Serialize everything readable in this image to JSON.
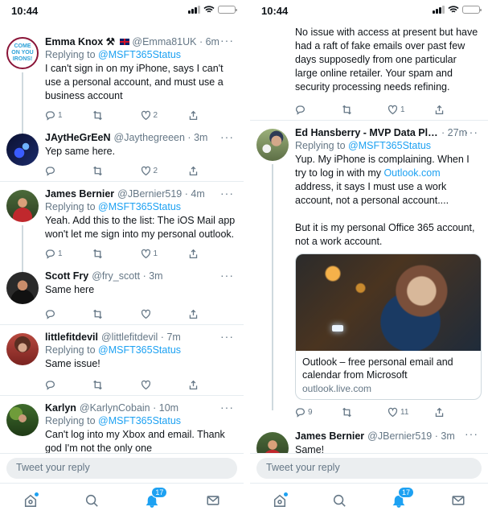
{
  "left": {
    "time": "10:44",
    "tweets": [
      {
        "name": "Emma Knox ⚒ ",
        "handle": "@Emma81UK · 6m",
        "replying_prefix": "Replying to ",
        "replying_to": "@MSFT365Status",
        "text": "I can't sign in on my iPhone, says I can't use a personal account, and must use a business account",
        "replies": "1",
        "retweets": "",
        "likes": "2"
      },
      {
        "name": "JAytHeGrEeN",
        "handle": "@Jaythegreeen · 3m",
        "text": "Yep same here.",
        "replies": "",
        "retweets": "",
        "likes": "2"
      },
      {
        "name": "James Bernier",
        "handle": "@JBernier519 · 4m",
        "replying_prefix": "Replying to ",
        "replying_to": "@MSFT365Status",
        "text": "Yeah. Add this to the list: The iOS Mail app won't let me sign into my personal outlook.",
        "replies": "1",
        "retweets": "",
        "likes": "1"
      },
      {
        "name": "Scott Fry",
        "handle": "@fry_scott · 3m",
        "text": "Same here",
        "replies": "",
        "retweets": "",
        "likes": ""
      },
      {
        "name": "littlefitdevil",
        "handle": "@littlefitdevil · 7m",
        "replying_prefix": "Replying to ",
        "replying_to": "@MSFT365Status",
        "text": "Same issue!",
        "replies": "",
        "retweets": "",
        "likes": ""
      },
      {
        "name": "Karlyn",
        "handle": "@KarlynCobain · 10m",
        "replying_prefix": "Replying to ",
        "replying_to": "@MSFT365Status",
        "text": "Can't log into my Xbox and email. Thank god I'm not the only one",
        "replies": "",
        "retweets": "",
        "likes": ""
      }
    ],
    "avatar_text": "COME ON YOU IRONS!",
    "reply_placeholder": "Tweet your reply",
    "badge": "17"
  },
  "right": {
    "time": "10:44",
    "top_text": "No issue with access at present but have had a raft of fake emails over past few days supposedly from one particular large online retailer. Your spam and security processing needs refining.",
    "top_counts": {
      "replies": "",
      "retweets": "",
      "likes": "1"
    },
    "tweet2": {
      "name": "Ed Hansberry - MVP Data Plat...",
      "handle": "· 27m",
      "replying_prefix": "Replying to ",
      "replying_to": "@MSFT365Status",
      "text_a": "Yup. My iPhone is complaining. When I try to log in with my ",
      "link": "Outlook.com",
      "text_b": " address, it says I must use a work account, not a personal account....",
      "text_c": "But it is my personal Office 365 account, not a work account.",
      "card_title": "Outlook – free personal email and calendar from Microsoft",
      "card_domain": "outlook.live.com",
      "replies": "9",
      "retweets": "",
      "likes": "11"
    },
    "tweet3": {
      "name": "James Bernier",
      "handle": "@JBernier519 · 3m",
      "text": "Same!"
    },
    "reply_placeholder": "Tweet your reply",
    "badge": "17"
  },
  "icons": {
    "reply": "reply-icon",
    "retweet": "retweet-icon",
    "like": "heart-icon",
    "share": "share-icon",
    "home": "home-icon",
    "search": "search-icon",
    "notifications": "bell-icon",
    "messages": "mail-icon",
    "more": "more-icon"
  },
  "colors": {
    "accent": "#1da1f2",
    "text": "#0f1419",
    "muted": "#657786"
  }
}
